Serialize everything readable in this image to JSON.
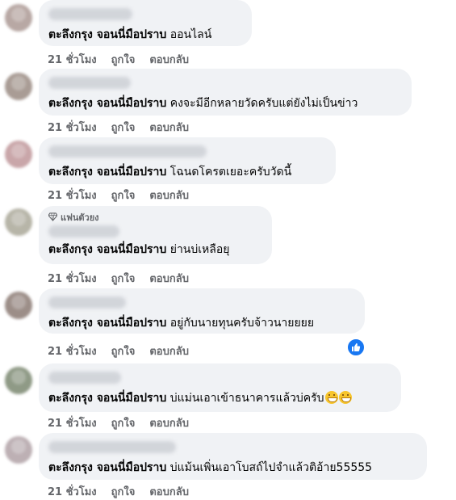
{
  "comments": [
    {
      "author": "ตะลึงกรุง จอนนี่มือปราบ",
      "text": "ออนไลน์",
      "time": "21 ชั่วโมง",
      "like": "ถูกใจ",
      "reply": "ตอบกลับ"
    },
    {
      "author": "ตะลึงกรุง จอนนี่มือปราบ",
      "text": "คงจะมีอีกหลายวัดครับแต่ยังไม่เป็นข่าว",
      "time": "21 ชั่วโมง",
      "like": "ถูกใจ",
      "reply": "ตอบกลับ"
    },
    {
      "author": "ตะลึงกรุง จอนนี่มือปราบ",
      "text": "โฉนดโครตเยอะครับวัดนี้",
      "time": "21 ชั่วโมง",
      "like": "ถูกใจ",
      "reply": "ตอบกลับ"
    },
    {
      "badge": "แฟนตัวยง",
      "author": "ตะลึงกรุง จอนนี่มือปราบ",
      "text": "ย่านบ่เหลือยุ",
      "time": "21 ชั่วโมง",
      "like": "ถูกใจ",
      "reply": "ตอบกลับ"
    },
    {
      "author": "ตะลึงกรุง จอนนี่มือปราบ",
      "text": "อยู่กับนายทุนครับจ้าวนายยยย",
      "time": "21 ชั่วโมง",
      "like": "ถูกใจ",
      "reply": "ตอบกลับ",
      "reaction_icon": "like-icon"
    },
    {
      "author": "ตะลึงกรุง จอนนี่มือปราบ",
      "text": "บ่แม่นเอาเข้าธนาคารแล้วบ่ครับ",
      "emoji": [
        "grin-emoji",
        "grin-emoji"
      ],
      "time": "21 ชั่วโมง",
      "like": "ถูกใจ",
      "reply": "ตอบกลับ"
    },
    {
      "author": "ตะลึงกรุง จอนนี่มือปราบ",
      "text": "บ่แม้นเพิ่นเอาโบสถ์ไปจำแล้วติอ้าย55555",
      "time": "21 ชั่วโมง",
      "like": "ถูกใจ",
      "reply": "ตอบกลับ"
    }
  ],
  "colors": {
    "bubble": "#f0f2f5",
    "meta": "#65676b",
    "like_badge": "#1877f2"
  }
}
